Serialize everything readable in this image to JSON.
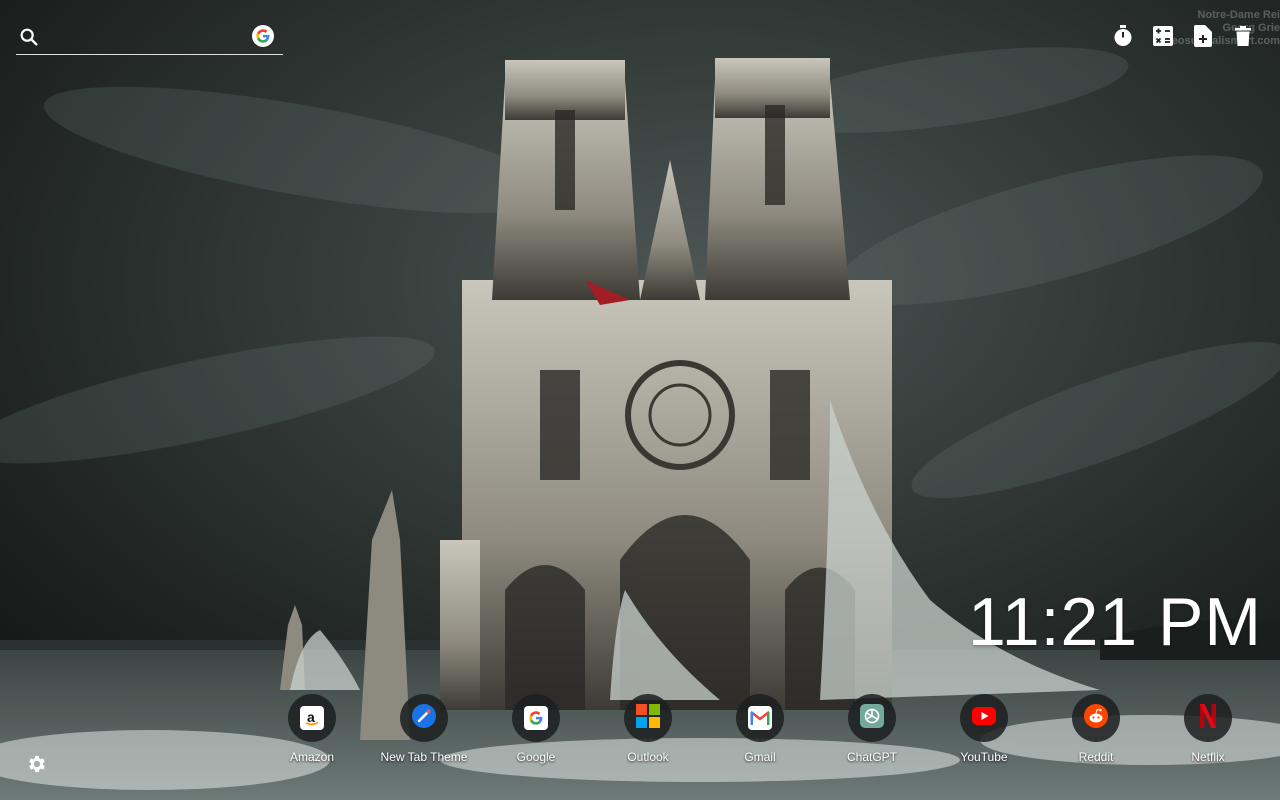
{
  "search": {
    "placeholder": "",
    "value": ""
  },
  "watermark": {
    "line1": "Notre-Dame Rei",
    "line2": "Georg Grie",
    "line3": "neosurrealismart.com"
  },
  "toolbar": {
    "icons": [
      "timer-icon",
      "calculator-icon",
      "add-note-icon",
      "trash-icon"
    ]
  },
  "clock": {
    "time": "11:21 PM"
  },
  "shortcuts": [
    {
      "label": "Amazon",
      "icon": "amazon-icon",
      "color": "#ff9900"
    },
    {
      "label": "New Tab Theme",
      "icon": "new-tab-theme-icon",
      "color": "#1a73e8"
    },
    {
      "label": "Google",
      "icon": "google-icon",
      "color": "#4285f4"
    },
    {
      "label": "Outlook",
      "icon": "microsoft-icon",
      "color": "#f25022"
    },
    {
      "label": "Gmail",
      "icon": "gmail-icon",
      "color": "#ea4335"
    },
    {
      "label": "ChatGPT",
      "icon": "chatgpt-icon",
      "color": "#74aa9c"
    },
    {
      "label": "YouTube",
      "icon": "youtube-icon",
      "color": "#ff0000"
    },
    {
      "label": "Reddit",
      "icon": "reddit-icon",
      "color": "#ff4500"
    },
    {
      "label": "Netflix",
      "icon": "netflix-icon",
      "color": "#e50914"
    }
  ],
  "colors": {
    "sky": "#2a302e",
    "water": "#4a5552",
    "stone": "#b8b5aa"
  }
}
